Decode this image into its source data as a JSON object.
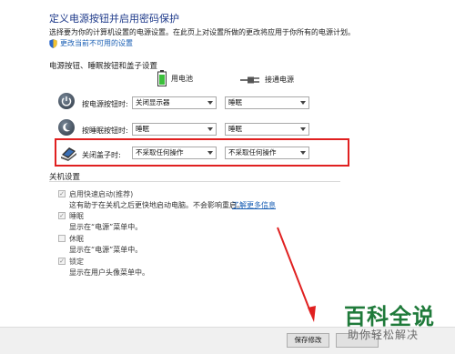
{
  "header": {
    "title": "定义电源按钮并启用密码保护",
    "description": "选择要为你的计算机设置的电源设置。在此页上对设置所做的更改将应用于你所有的电源计划。",
    "admin_link": "更改当前不可用的设置"
  },
  "buttons_section": {
    "title": "电源按钮、睡眠按钮和盖子设置",
    "col_battery": "用电池",
    "col_plugged": "接通电源",
    "rows": [
      {
        "label": "按电源按钮时:",
        "battery": "关闭显示器",
        "plugged": "睡眠"
      },
      {
        "label": "按睡眠按钮时:",
        "battery": "睡眠",
        "plugged": "睡眠"
      },
      {
        "label": "关闭盖子时:",
        "battery": "不采取任何操作",
        "plugged": "不采取任何操作"
      }
    ]
  },
  "shutdown_section": {
    "title": "关机设置",
    "options": [
      {
        "label": "启用快速启动(推荐)",
        "checked": true,
        "desc": "这有助于在关机之后更快地启动电脑。不会影响重启。",
        "link": "了解更多信息"
      },
      {
        "label": "睡眠",
        "checked": true,
        "desc": "显示在“电源”菜单中。"
      },
      {
        "label": "休眠",
        "checked": false,
        "desc": "显示在“电源”菜单中。"
      },
      {
        "label": "锁定",
        "checked": true,
        "desc": "显示在用户头像菜单中。"
      }
    ]
  },
  "footer": {
    "save_label": "保存修改"
  },
  "watermark": {
    "main": "百科全说",
    "sub": "助你轻松解决"
  },
  "colors": {
    "title": "#1e3a8a",
    "link": "#1a5fb4",
    "highlight": "#e02020",
    "watermark": "#1f7a3a"
  }
}
